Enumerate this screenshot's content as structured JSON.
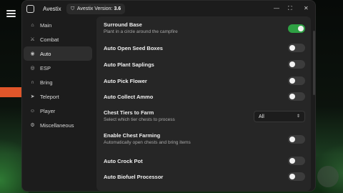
{
  "window": {
    "title": "Avestix",
    "version_label": "Avestix Version:",
    "version_value": "3.6",
    "controls": [
      "—",
      "⛶",
      "✕"
    ]
  },
  "sidebar": {
    "items": [
      {
        "label": "Main",
        "icon": "home-icon",
        "glyph": "⌂"
      },
      {
        "label": "Combat",
        "icon": "sword-icon",
        "glyph": "⚔"
      },
      {
        "label": "Auto",
        "icon": "bot-icon",
        "glyph": "◉"
      },
      {
        "label": "ESP",
        "icon": "eye-icon",
        "glyph": "◎"
      },
      {
        "label": "Bring",
        "icon": "magnet-icon",
        "glyph": "∩"
      },
      {
        "label": "Teleport",
        "icon": "send-icon",
        "glyph": "➤"
      },
      {
        "label": "Player",
        "icon": "user-icon",
        "glyph": "☺"
      },
      {
        "label": "Miscellaneous",
        "icon": "cog-icon",
        "glyph": "⚙"
      }
    ],
    "active_index": 2
  },
  "settings": [
    {
      "key": "surround_base",
      "label": "Surround Base",
      "desc": "Plant in a circle around the campfire",
      "type": "toggle",
      "on": true
    },
    {
      "key": "auto_open_seed_boxes",
      "label": "Auto Open Seed Boxes",
      "type": "toggle",
      "on": false
    },
    {
      "key": "auto_plant_saplings",
      "label": "Auto Plant Saplings",
      "type": "toggle",
      "on": false
    },
    {
      "key": "auto_pick_flower",
      "label": "Auto Pick Flower",
      "type": "toggle",
      "on": false
    },
    {
      "key": "auto_collect_ammo",
      "label": "Auto Collect Ammo",
      "type": "toggle",
      "on": false
    },
    {
      "key": "chest_tiers_to_farm",
      "label": "Chest Tiers to Farm",
      "desc": "Select which tier chests to process",
      "type": "select",
      "value": "All"
    },
    {
      "key": "enable_chest_farming",
      "label": "Enable Chest Farming",
      "desc": "Automatically open chests and bring items",
      "type": "toggle",
      "on": false
    },
    {
      "key": "auto_crock_pot",
      "label": "Auto Crock Pot",
      "type": "toggle",
      "on": false
    },
    {
      "key": "auto_biofuel_processor",
      "label": "Auto Biofuel Processor",
      "type": "toggle",
      "on": false
    }
  ],
  "colors": {
    "toggle_on": "#2ea043",
    "toggle_off": "#3c3c3c",
    "panel": "#262626",
    "window": "#1c1c1c"
  }
}
